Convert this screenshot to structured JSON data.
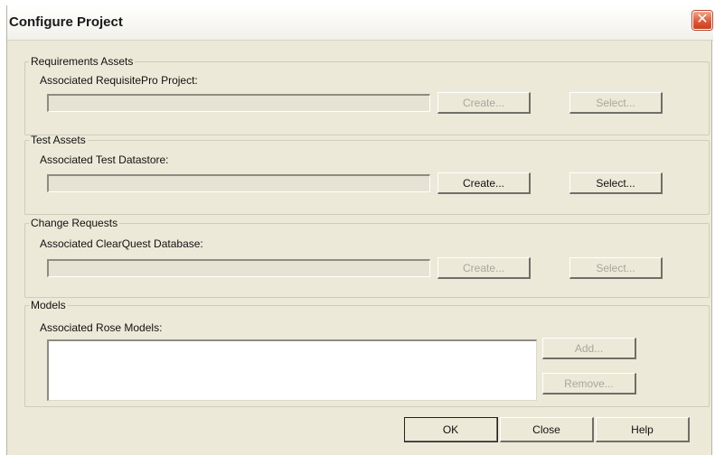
{
  "dialog": {
    "title": "Configure Project",
    "close_glyph": "✕"
  },
  "requirements": {
    "group_title": "Requirements Assets",
    "label": "Associated RequisitePro Project:",
    "value": "",
    "create_label": "Create...",
    "select_label": "Select...",
    "enabled": false
  },
  "test": {
    "group_title": "Test Assets",
    "label": "Associated Test Datastore:",
    "value": "",
    "create_label": "Create...",
    "select_label": "Select...",
    "enabled": true
  },
  "change": {
    "group_title": "Change Requests",
    "label": "Associated ClearQuest Database:",
    "value": "",
    "create_label": "Create...",
    "select_label": "Select...",
    "enabled": false
  },
  "models": {
    "group_title": "Models",
    "label": "Associated Rose Models:",
    "items": [],
    "add_label": "Add...",
    "remove_label": "Remove..."
  },
  "footer": {
    "ok_label": "OK",
    "close_label": "Close",
    "help_label": "Help"
  }
}
